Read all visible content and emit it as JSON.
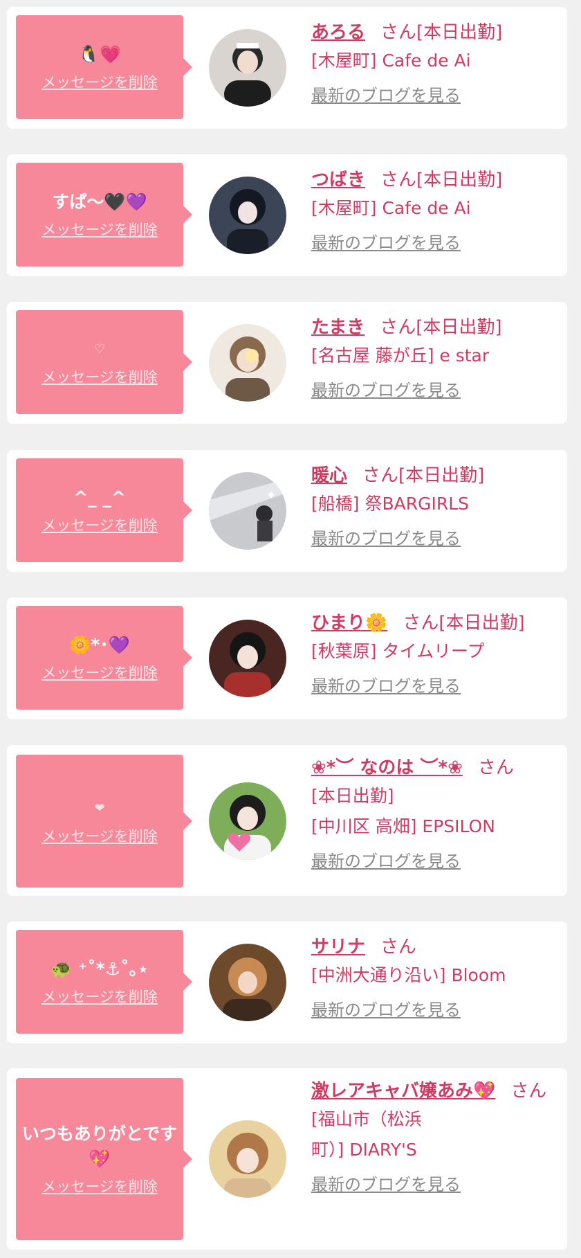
{
  "common": {
    "delete_label": "メッセージを削除",
    "blog_label": "最新のブログを見る",
    "san_label": "さん"
  },
  "items": [
    {
      "message": "🐧💗",
      "name": "あろる",
      "status": "[本日出勤]",
      "shop": "[木屋町] Cafe de Ai"
    },
    {
      "message": "すぱ〜🖤💜",
      "name": "つばき",
      "status": "[本日出勤]",
      "shop": "[木屋町] Cafe de Ai"
    },
    {
      "message": "♡",
      "name": "たまき",
      "status": "[本日出勤]",
      "shop": "[名古屋 藤が丘] e star"
    },
    {
      "message": "^_ _^",
      "name": "暖心",
      "status": "[本日出勤]",
      "shop": "[船橋] 祭BARGIRLS"
    },
    {
      "message": "🌼*･💜",
      "name": "ひまり🌼",
      "status": "[本日出勤]",
      "shop": "[秋葉原] タイムリープ"
    },
    {
      "message": "❤",
      "name": "❀*︶ なのは ︶*❀",
      "status": "[本日出勤]",
      "shop": "[中川区 高畑] EPSILON"
    },
    {
      "message": "🐢 ⁺˚*⚓˚｡⋆",
      "name": "サリナ",
      "status": "",
      "shop": "[中洲大通り沿い] Bloom"
    },
    {
      "message": "いつもありがとです💖",
      "name": "激レアキャバ嬢あみ💖",
      "status": "",
      "shop": "[福山市（松浜町）] DIARY'S"
    }
  ],
  "colors": {
    "background": "#f0f0f0",
    "card": "#ffffff",
    "bubble": "#f7889a",
    "accent_text": "#d33a62",
    "link_gray": "#8a8a8a"
  }
}
